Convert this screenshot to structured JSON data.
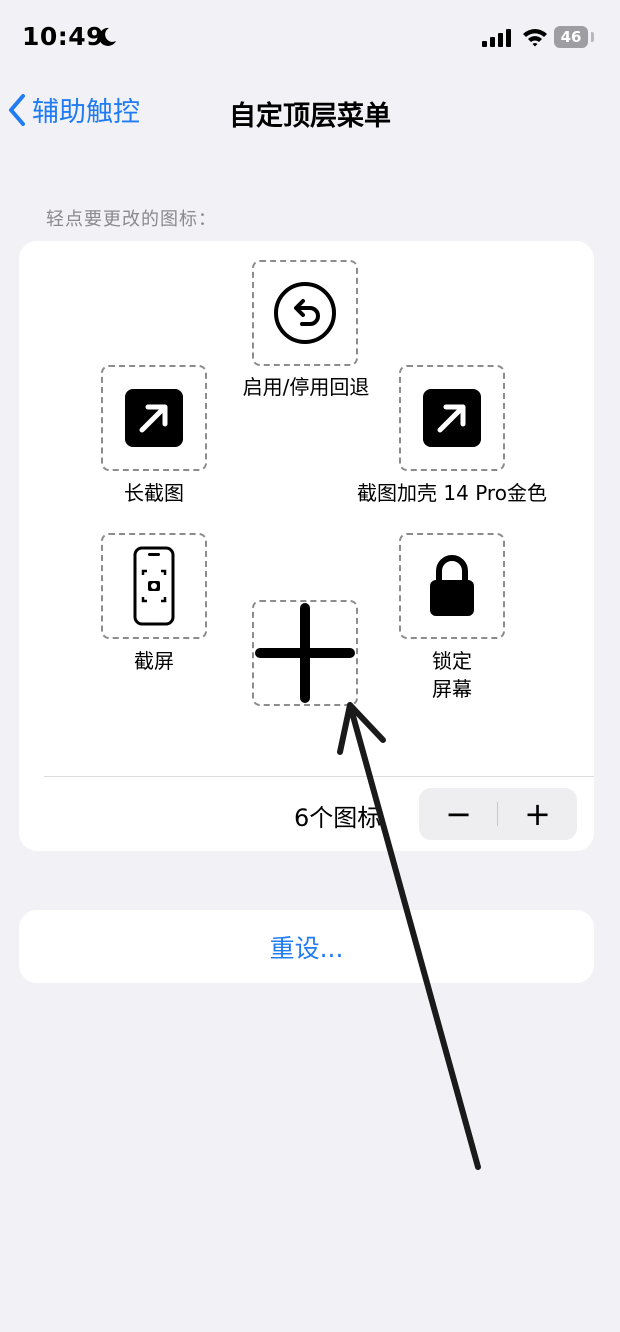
{
  "status_bar": {
    "time": "10:49",
    "battery_level": "46"
  },
  "nav": {
    "back_label": "辅助触控",
    "title": "自定顶层菜单"
  },
  "section_caption": "轻点要更改的图标：",
  "icons": [
    {
      "label": "启用/停用回退",
      "icon": "undo-circle-icon"
    },
    {
      "label": "长截图",
      "icon": "arrow-up-right-square-icon"
    },
    {
      "label": "截图加壳 14 Pro金色",
      "icon": "arrow-up-right-square-icon"
    },
    {
      "label": "截屏",
      "icon": "phone-screenshot-icon"
    },
    {
      "label": "锁定",
      "label_line2": "屏幕",
      "icon": "lock-icon"
    }
  ],
  "add_slot_icon": "plus-icon",
  "icon_count": "6个图标",
  "stepper": {
    "minus": "−",
    "plus": "+"
  },
  "reset_label": "重设...",
  "colors": {
    "accent": "#1f7cf2",
    "background": "#f2f1f6",
    "card": "#ffffff"
  }
}
